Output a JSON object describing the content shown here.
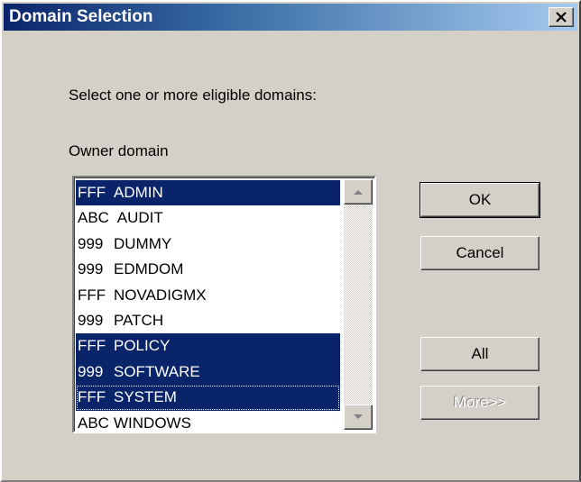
{
  "window": {
    "title": "Domain Selection",
    "close_label": "X"
  },
  "prompt": "Select one or more eligible domains:",
  "list": {
    "header": "Owner  domain",
    "items": [
      {
        "code": "FFF",
        "name": "ADMIN",
        "selected": true
      },
      {
        "code": "ABC",
        "name": " AUDIT",
        "selected": false
      },
      {
        "code": "999",
        "name": "DUMMY",
        "selected": false
      },
      {
        "code": "999",
        "name": "EDMDOM",
        "selected": false
      },
      {
        "code": "FFF",
        "name": "NOVADIGMX",
        "selected": false
      },
      {
        "code": "999",
        "name": "PATCH",
        "selected": false
      },
      {
        "code": "FFF",
        "name": "POLICY",
        "selected": true
      },
      {
        "code": "999",
        "name": "SOFTWARE",
        "selected": true
      },
      {
        "code": "FFF",
        "name": "SYSTEM",
        "selected": true,
        "focused": true
      },
      {
        "code": "ABC",
        "name": "WINDOWS",
        "selected": false
      }
    ]
  },
  "buttons": {
    "ok": "OK",
    "cancel": "Cancel",
    "all": "All",
    "more": "More>>"
  },
  "colors": {
    "selection": "#0a246a",
    "face": "#d4d0c8"
  }
}
